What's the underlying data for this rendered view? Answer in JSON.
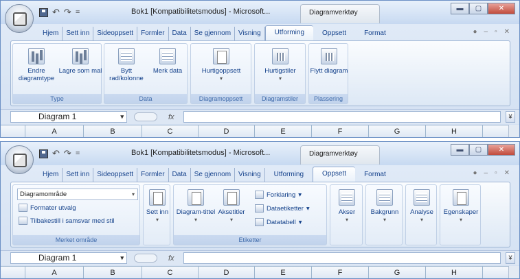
{
  "window1": {
    "qat": {
      "undo": "↶",
      "redo": "↷",
      "sep": "▾",
      "customize": "="
    },
    "title": "Bok1  [Kompatibilitetsmodus] - Microsoft...",
    "tool_context": "Diagramverktøy",
    "tabs": [
      "Hjem",
      "Sett inn",
      "Sideoppsett",
      "Formler",
      "Data",
      "Se gjennom",
      "Visning",
      "Utforming",
      "Oppsett",
      "Format"
    ],
    "active_tab": "Utforming",
    "groups": {
      "type": {
        "label": "Type",
        "btn1": "Endre diagramtype",
        "btn2": "Lagre som mal"
      },
      "data": {
        "label": "Data",
        "btn1": "Bytt rad/kolonne",
        "btn2": "Merk data"
      },
      "layout": {
        "label": "Diagramoppsett",
        "btn1": "Hurtigoppsett"
      },
      "styles": {
        "label": "Diagramstiler",
        "btn1": "Hurtigstiler"
      },
      "placement": {
        "label": "Plassering",
        "btn1": "Flytt diagram"
      }
    },
    "namebox": "Diagram 1",
    "fx": "fx",
    "columns": [
      "A",
      "B",
      "C",
      "D",
      "E",
      "F",
      "G",
      "H"
    ]
  },
  "window2": {
    "qat": {
      "undo": "↶",
      "redo": "↷",
      "sep": "▾",
      "customize": "="
    },
    "title": "Bok1  [Kompatibilitetsmodus] - Microsoft...",
    "tool_context": "Diagramverktøy",
    "tabs": [
      "Hjem",
      "Sett inn",
      "Sideoppsett",
      "Formler",
      "Data",
      "Se gjennom",
      "Visning",
      "Utforming",
      "Oppsett",
      "Format"
    ],
    "active_tab": "Oppsett",
    "groups": {
      "selection": {
        "label": "Merket område",
        "combo": "Diagramområde",
        "btn1": "Formater utvalg",
        "btn2": "Tilbakestill i samsvar med stil"
      },
      "insert": {
        "btn1": "Sett inn"
      },
      "labels": {
        "label": "Etiketter",
        "btn1": "Diagram-tittel",
        "btn2": "Aksetitler",
        "btn3": "Forklaring",
        "btn4": "Dataetiketter",
        "btn5": "Datatabell"
      },
      "axes": {
        "btn1": "Akser"
      },
      "background": {
        "btn1": "Bakgrunn"
      },
      "analysis": {
        "btn1": "Analyse"
      },
      "properties": {
        "btn1": "Egenskaper"
      }
    },
    "namebox": "Diagram 1",
    "fx": "fx",
    "columns": [
      "A",
      "B",
      "C",
      "D",
      "E",
      "F",
      "G",
      "H"
    ]
  },
  "icons": [
    "office-button-icon",
    "save-icon",
    "undo-icon",
    "redo-icon",
    "minimize-icon",
    "maximize-icon",
    "close-icon",
    "help-icon",
    "dropdown-arrow-icon",
    "expand-formula-bar-icon"
  ],
  "colors": {
    "ribbon_bg": "#dde8f5",
    "tab_text": "#15428b",
    "group_label": "#3e6aaa",
    "close_button": "#c14b3c"
  }
}
